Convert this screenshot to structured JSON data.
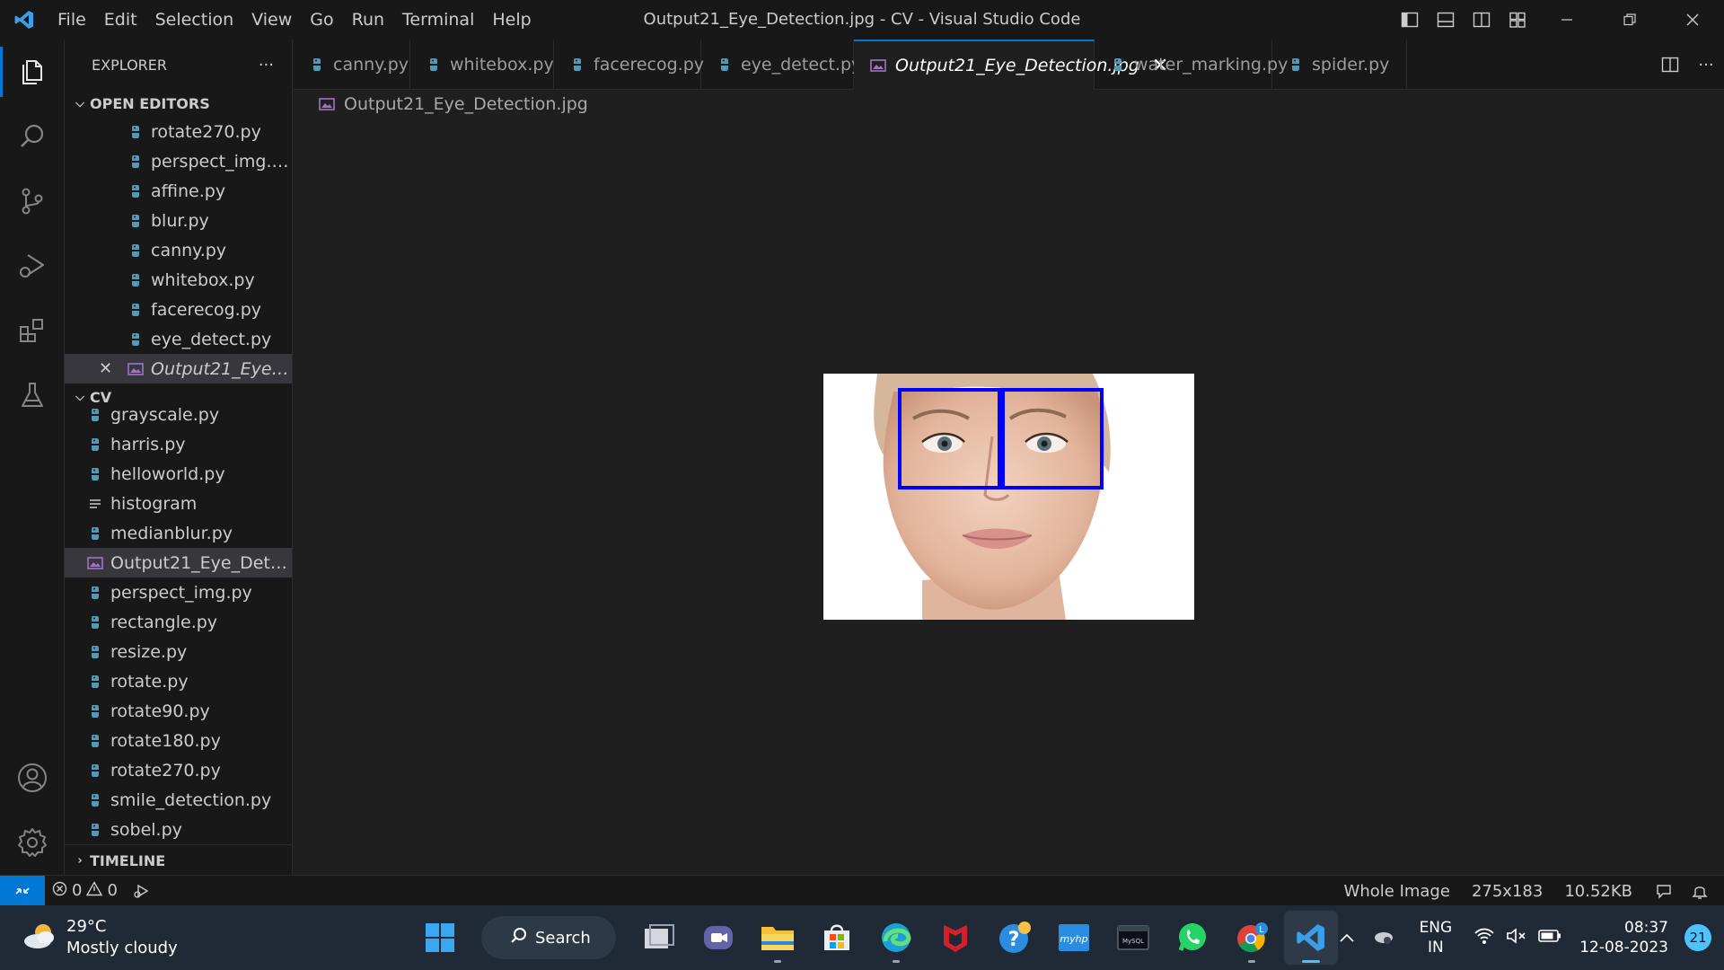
{
  "window": {
    "title": "Output21_Eye_Detection.jpg - CV - Visual Studio Code",
    "menu": [
      "File",
      "Edit",
      "Selection",
      "View",
      "Go",
      "Run",
      "Terminal",
      "Help"
    ]
  },
  "sidebar": {
    "title": "EXPLORER",
    "more": "···",
    "open_editors": {
      "title": "OPEN EDITORS",
      "items": [
        {
          "label": "rotate270.py",
          "type": "python"
        },
        {
          "label": "perspect_img.py",
          "type": "python"
        },
        {
          "label": "affine.py",
          "type": "python"
        },
        {
          "label": "blur.py",
          "type": "python"
        },
        {
          "label": "canny.py",
          "type": "python"
        },
        {
          "label": "whitebox.py",
          "type": "python"
        },
        {
          "label": "facerecog.py",
          "type": "python"
        },
        {
          "label": "eye_detect.py",
          "type": "python"
        },
        {
          "label": "Output21_Eye_D...",
          "type": "image",
          "active": true
        }
      ]
    },
    "folder": {
      "title": "CV",
      "items": [
        {
          "label": "grayscale.py",
          "type": "python"
        },
        {
          "label": "harris.py",
          "type": "python"
        },
        {
          "label": "helloworld.py",
          "type": "python"
        },
        {
          "label": "histogram",
          "type": "text"
        },
        {
          "label": "medianblur.py",
          "type": "python"
        },
        {
          "label": "Output21_Eye_Detect...",
          "type": "image",
          "selected": true
        },
        {
          "label": "perspect_img.py",
          "type": "python"
        },
        {
          "label": "rectangle.py",
          "type": "python"
        },
        {
          "label": "resize.py",
          "type": "python"
        },
        {
          "label": "rotate.py",
          "type": "python"
        },
        {
          "label": "rotate90.py",
          "type": "python"
        },
        {
          "label": "rotate180.py",
          "type": "python"
        },
        {
          "label": "rotate270.py",
          "type": "python"
        },
        {
          "label": "smile_detection.py",
          "type": "python"
        },
        {
          "label": "sobel.py",
          "type": "python"
        }
      ]
    },
    "timeline": "TIMELINE"
  },
  "tabs": [
    {
      "label": "canny.py",
      "type": "python"
    },
    {
      "label": "whitebox.py",
      "type": "python"
    },
    {
      "label": "facerecog.py",
      "type": "python"
    },
    {
      "label": "eye_detect.py",
      "type": "python"
    },
    {
      "label": "Output21_Eye_Detection.jpg",
      "type": "image",
      "active": true
    },
    {
      "label": "water_marking.py",
      "type": "python"
    },
    {
      "label": "spider.py",
      "type": "python"
    }
  ],
  "breadcrumb": "Output21_Eye_Detection.jpg",
  "statusbar": {
    "errors": "0",
    "warnings": "0",
    "zoom": "Whole Image",
    "dimensions": "275x183",
    "filesize": "10.52KB"
  },
  "taskbar": {
    "weather_temp": "29°C",
    "weather_desc": "Mostly cloudy",
    "search_label": "Search",
    "lang_top": "ENG",
    "lang_bottom": "IN",
    "time": "08:37",
    "date": "12-08-2023",
    "notifications": "21"
  },
  "colors": {
    "accent": "#0078d4",
    "python_icon": "#519aba",
    "image_icon": "#a074c4",
    "detection_box": "#0000ff"
  }
}
